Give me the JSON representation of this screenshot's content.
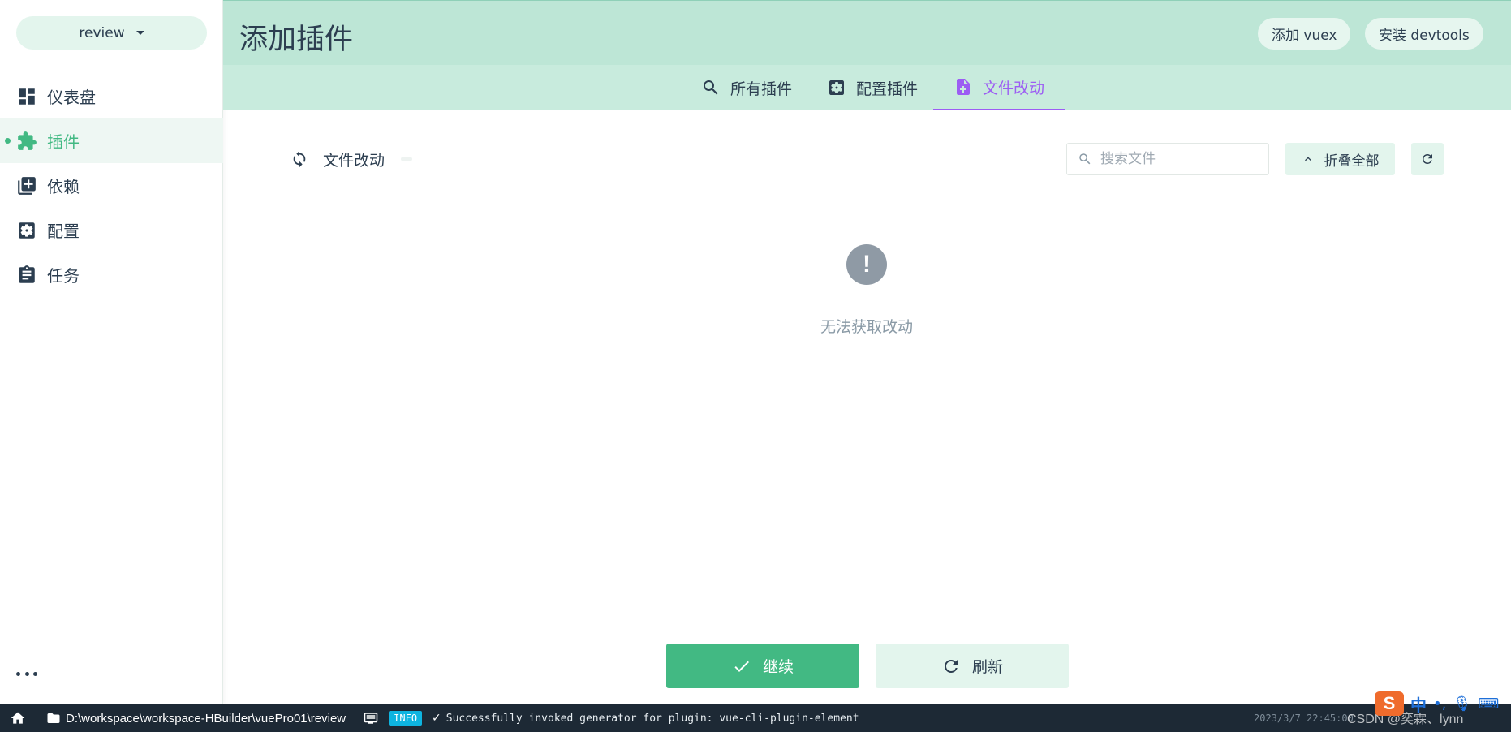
{
  "project": {
    "name": "review"
  },
  "sidebar": {
    "items": [
      {
        "label": "仪表盘",
        "icon": "dashboard-icon"
      },
      {
        "label": "插件",
        "icon": "puzzle-icon"
      },
      {
        "label": "依赖",
        "icon": "library-books-icon"
      },
      {
        "label": "配置",
        "icon": "settings-box-icon"
      },
      {
        "label": "任务",
        "icon": "clipboard-icon"
      }
    ],
    "active_index": 1
  },
  "header": {
    "title": "添加插件",
    "add_vuex_label": "添加 vuex",
    "install_devtools_label": "安装 devtools"
  },
  "tabs": [
    {
      "label": "所有插件",
      "icon": "search-icon"
    },
    {
      "label": "配置插件",
      "icon": "settings-box-icon"
    },
    {
      "label": "文件改动",
      "icon": "file-plus-icon",
      "active": true
    }
  ],
  "toolbar": {
    "title": "文件改动",
    "search_placeholder": "搜索文件",
    "collapse_label": "折叠全部"
  },
  "empty_state": {
    "icon": "exclamation-circle-icon",
    "message": "无法获取改动"
  },
  "actions": {
    "continue_label": "继续",
    "refresh_label": "刷新"
  },
  "statusbar": {
    "path": "D:\\workspace\\workspace-HBuilder\\vuePro01\\review",
    "badge": "INFO",
    "check": "✓",
    "message": "Successfully invoked generator for plugin: vue-cli-plugin-element",
    "time": "2023/3/7 22:45:00"
  },
  "overlay": {
    "ime_logo": "S",
    "ime_lang": "中",
    "watermark": "CSDN @奕霖、lynn"
  },
  "colors": {
    "accent": "#42b983",
    "active_tab": "#9c5df3",
    "header_bg": "#bde6d6",
    "tabs_bg": "#c8ebdd",
    "statusbar_bg": "#1d2935"
  }
}
